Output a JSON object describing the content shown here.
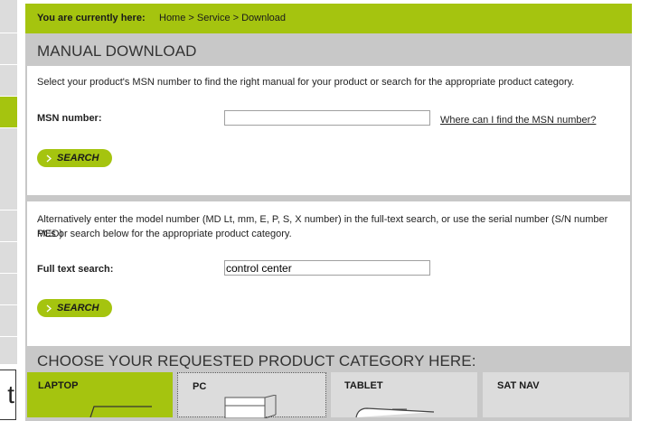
{
  "sidebar": {
    "box_text": "t"
  },
  "breadcrumb": {
    "lead": "You are currently here:",
    "trail": "Home > Service > Download"
  },
  "manual_download": {
    "title": "MANUAL DOWNLOAD",
    "intro": "Select your product's MSN number to find the right manual for your product or search for the appropriate product category.",
    "msn_label": "MSN number:",
    "msn_value": "",
    "help_link": "Where can I find the MSN number?",
    "search_label": "SEARCH"
  },
  "fulltext": {
    "intro_line1": "Alternatively enter the model number (MD Lt, mm, E, P, S, X number) in the full-text search, or use the serial number (S/N number MED)",
    "intro_line2": "PCs or search below  for the appropriate product category.",
    "label": "Full text search:",
    "value": "control center",
    "search_label": "SEARCH"
  },
  "categories": {
    "title": "CHOOSE YOUR REQUESTED PRODUCT CATEGORY HERE:",
    "items": [
      {
        "label": "LAPTOP",
        "icon": "laptop-icon",
        "active": true
      },
      {
        "label": "PC",
        "icon": "pc-tower-icon",
        "active": false
      },
      {
        "label": "TABLET",
        "icon": "tablet-icon",
        "active": false
      },
      {
        "label": "SAT NAV",
        "icon": "sat-nav-icon",
        "active": false
      }
    ]
  },
  "colors": {
    "accent": "#a5c40f",
    "panel_gray": "#c8c8c8",
    "tile_gray": "#dcdcdc"
  }
}
